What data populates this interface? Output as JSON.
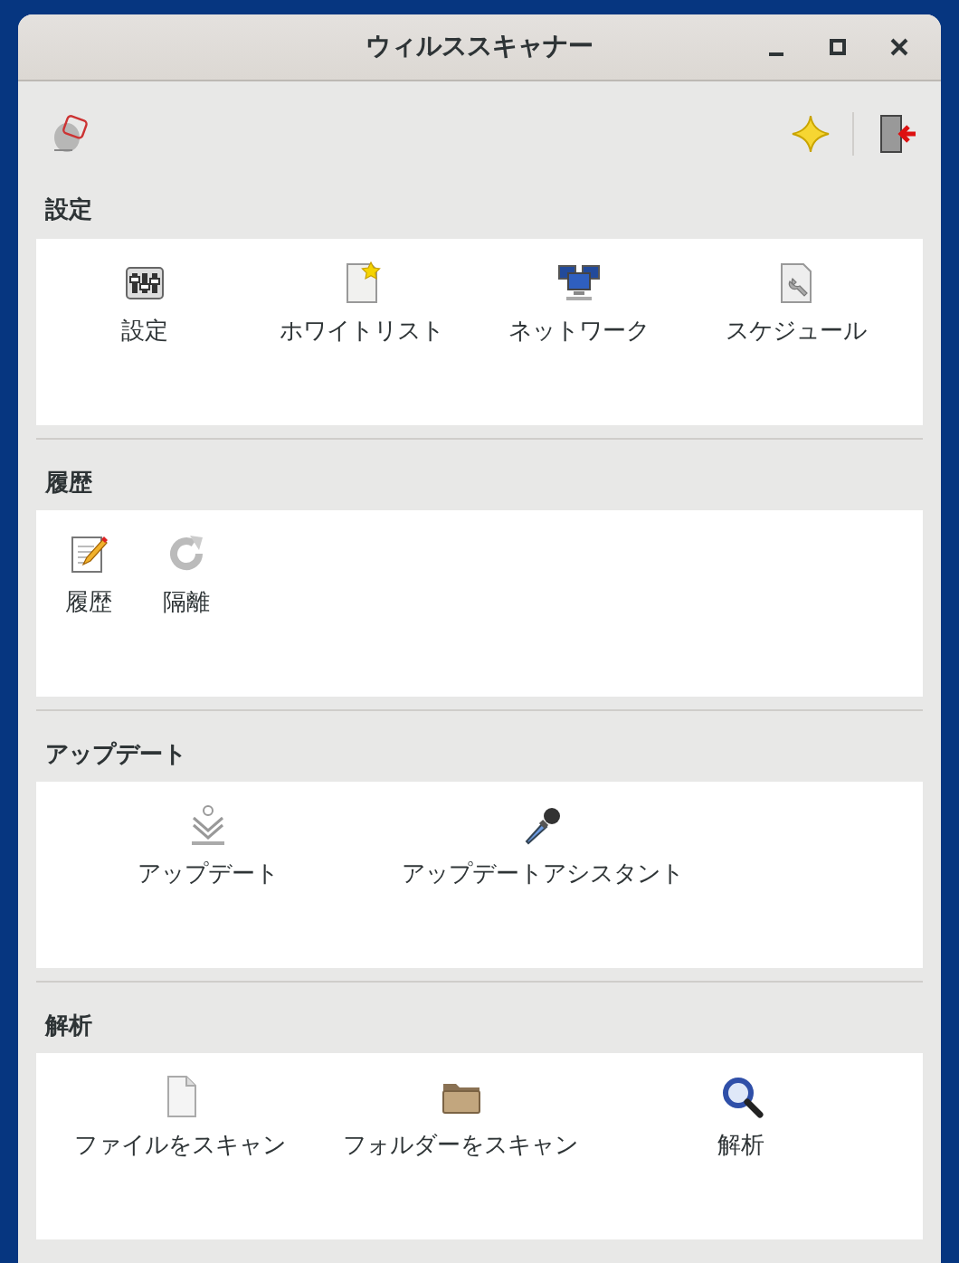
{
  "window": {
    "title": "ウィルススキャナー"
  },
  "sections": [
    {
      "title": "設定",
      "kind": "quad",
      "items": [
        {
          "label": "設定",
          "kind": "sliders"
        },
        {
          "label": "ホワイトリスト",
          "kind": "starpage"
        },
        {
          "label": "ネットワーク",
          "kind": "network"
        },
        {
          "label": "スケジュール",
          "kind": "wrenchpage"
        }
      ]
    },
    {
      "title": "履歴",
      "kind": "compact",
      "items": [
        {
          "label": "履歴",
          "kind": "pencil"
        },
        {
          "label": "隔離",
          "kind": "reload"
        }
      ]
    },
    {
      "title": "アップデート",
      "kind": "pair",
      "items": [
        {
          "label": "アップデート",
          "kind": "download"
        },
        {
          "label": "アップデートアシスタント",
          "kind": "dropper"
        }
      ]
    },
    {
      "title": "解析",
      "kind": "triple",
      "items": [
        {
          "label": "ファイルをスキャン",
          "kind": "file"
        },
        {
          "label": "フォルダーをスキャン",
          "kind": "folder"
        },
        {
          "label": "解析",
          "kind": "search"
        }
      ]
    }
  ]
}
